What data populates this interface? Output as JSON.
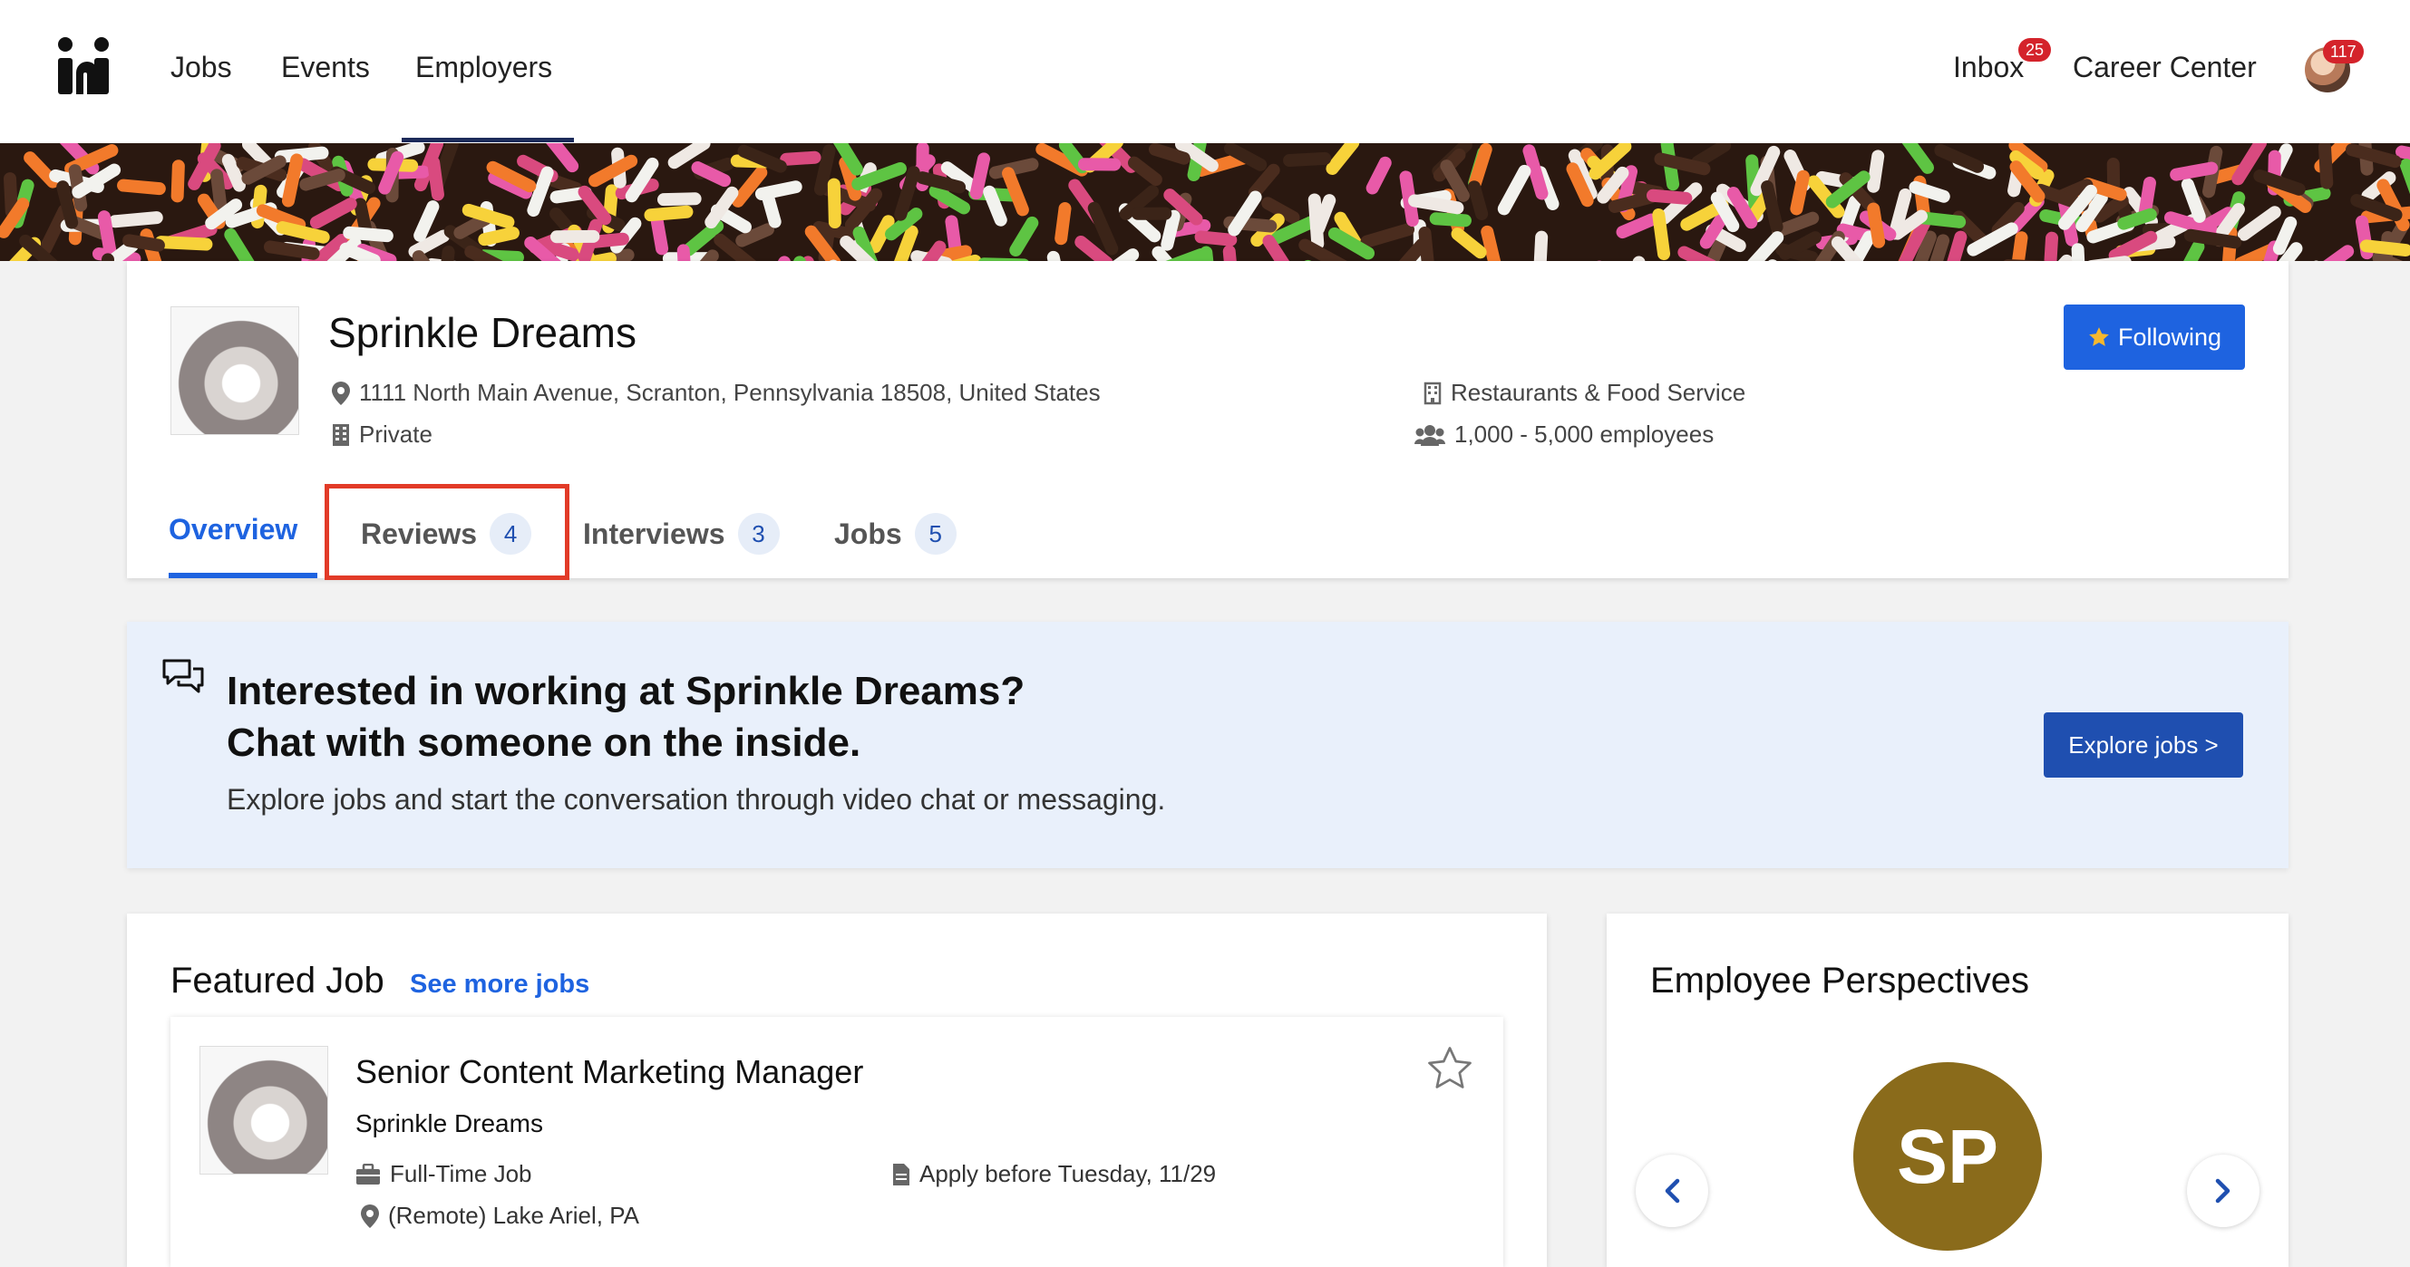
{
  "nav": {
    "links": [
      "Jobs",
      "Events",
      "Employers"
    ],
    "active": "Employers",
    "inbox_label": "Inbox",
    "inbox_count": "25",
    "career_center_label": "Career Center",
    "profile_count": "117"
  },
  "company": {
    "name": "Sprinkle Dreams",
    "address": "1111 North Main Avenue, Scranton, Pennsylvania 18508, United States",
    "ownership": "Private",
    "industry": "Restaurants & Food Service",
    "size": "1,000 - 5,000 employees",
    "follow_label": "Following"
  },
  "tabs": [
    {
      "label": "Overview"
    },
    {
      "label": "Reviews",
      "count": "4"
    },
    {
      "label": "Interviews",
      "count": "3"
    },
    {
      "label": "Jobs",
      "count": "5"
    }
  ],
  "chat_banner": {
    "title_line1": "Interested in working at Sprinkle Dreams?",
    "title_line2": "Chat with someone on the inside.",
    "subtitle": "Explore jobs and start the conversation through video chat or messaging.",
    "button": "Explore jobs >"
  },
  "featured": {
    "heading": "Featured Job",
    "see_more": "See more jobs",
    "job": {
      "title": "Senior Content Marketing Manager",
      "employer": "Sprinkle Dreams",
      "type": "Full-Time Job",
      "deadline": "Apply before Tuesday, 11/29",
      "location": "(Remote) Lake Ariel, PA"
    }
  },
  "perspectives": {
    "heading": "Employee Perspectives",
    "initials": "SP"
  },
  "colors": {
    "primary": "#1e63e0",
    "dark_primary": "#1f4fb0",
    "badge_red": "#d4232b",
    "highlight": "#e23b28",
    "avatar_gold": "#8a6b1b"
  }
}
